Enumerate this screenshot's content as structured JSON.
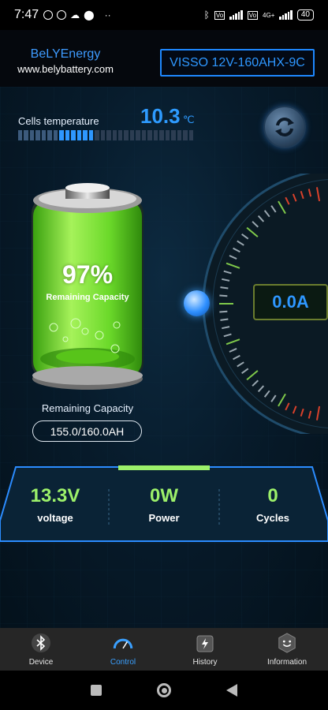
{
  "status_bar": {
    "time": "7:47",
    "network": "4G+",
    "battery": "40"
  },
  "header": {
    "brand_name": "BeLYEnergy",
    "brand_url": "www.belybattery.com",
    "model_button": "VISSO 12V-160AHX-9C"
  },
  "temperature": {
    "label": "Cells temperature",
    "value": "10.3",
    "unit": "℃",
    "level": 0.42
  },
  "battery": {
    "percent": "97%",
    "percent_caption": "Remaining Capacity",
    "remaining_label": "Remaining Capacity",
    "remaining_value": "155.0/160.0AH"
  },
  "gauge": {
    "current": "0.0A"
  },
  "stats": [
    {
      "value": "13.3V",
      "label": "voltage"
    },
    {
      "value": "0W",
      "label": "Power"
    },
    {
      "value": "0",
      "label": "Cycles"
    }
  ],
  "nav": [
    {
      "label": "Device",
      "icon": "bluetooth-icon"
    },
    {
      "label": "Control",
      "icon": "speedometer-icon"
    },
    {
      "label": "History",
      "icon": "history-icon"
    },
    {
      "label": "Information",
      "icon": "smiley-icon"
    }
  ],
  "colors": {
    "accent": "#2e97ff",
    "stat_green": "#9cf06a",
    "battery_green": "#6be022"
  }
}
